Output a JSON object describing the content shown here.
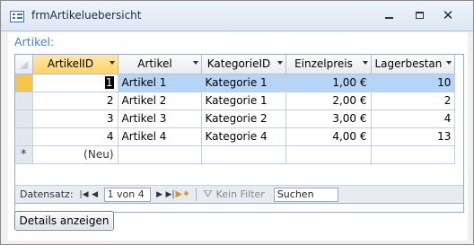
{
  "window": {
    "title": "frmArtikeluebersicht"
  },
  "form": {
    "label": "Artikel:"
  },
  "grid": {
    "columns": [
      "ArtikelID",
      "Artikel",
      "KategorieID",
      "Einzelpreis",
      "Lagerbestan"
    ],
    "rows": [
      [
        "1",
        "Artikel 1",
        "Kategorie 1",
        "1,00 €",
        "10"
      ],
      [
        "2",
        "Artikel 2",
        "Kategorie 1",
        "2,00 €",
        "2"
      ],
      [
        "3",
        "Artikel 3",
        "Kategorie 2",
        "3,00 €",
        "4"
      ],
      [
        "4",
        "Artikel 4",
        "Kategorie 4",
        "4,00 €",
        "13"
      ]
    ],
    "new_row_marker": "*",
    "new_row_text": "(Neu)"
  },
  "navbar": {
    "label": "Datensatz:",
    "record": "1 von 4",
    "filter": "Kein Filter",
    "search": "Suchen"
  },
  "buttons": {
    "details": "Details anzeigen"
  }
}
